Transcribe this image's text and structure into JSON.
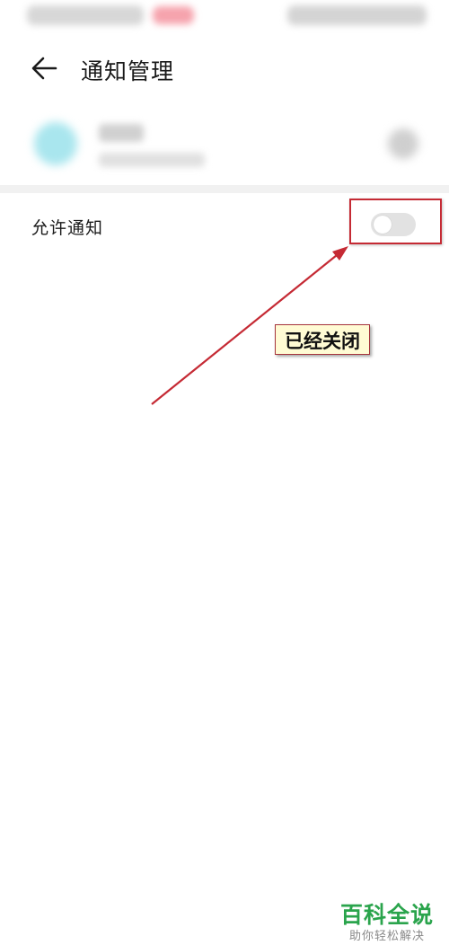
{
  "header": {
    "title": "通知管理",
    "back_icon": "arrow-left-icon"
  },
  "settings": {
    "allow_notifications": {
      "label": "允许通知",
      "enabled": false
    }
  },
  "annotation": {
    "callout_text": "已经关闭",
    "color": "#c52a34",
    "callout_bg": "#fffbd4"
  },
  "watermark": {
    "brand": "百科全说",
    "tagline": "助你轻松解决",
    "color": "#2aa44c"
  }
}
